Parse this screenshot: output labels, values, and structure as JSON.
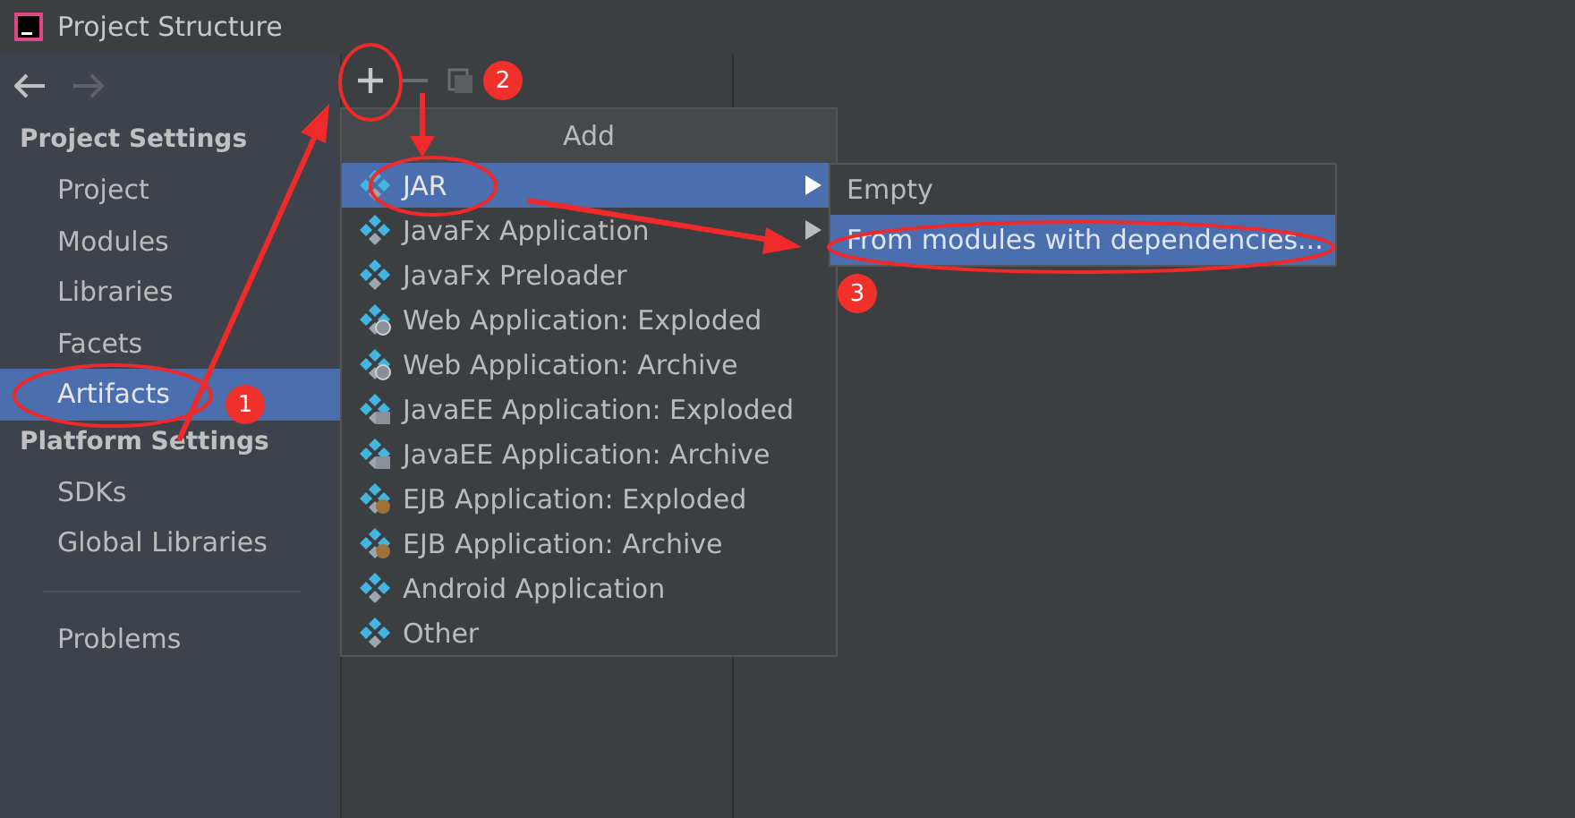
{
  "window": {
    "title": "Project Structure"
  },
  "sidebar": {
    "sections": [
      {
        "title": "Project Settings",
        "items": [
          {
            "label": "Project",
            "selected": false
          },
          {
            "label": "Modules",
            "selected": false
          },
          {
            "label": "Libraries",
            "selected": false
          },
          {
            "label": "Facets",
            "selected": false
          },
          {
            "label": "Artifacts",
            "selected": true
          }
        ]
      },
      {
        "title": "Platform Settings",
        "items": [
          {
            "label": "SDKs",
            "selected": false
          },
          {
            "label": "Global Libraries",
            "selected": false
          }
        ]
      }
    ],
    "footer_items": [
      {
        "label": "Problems",
        "selected": false
      }
    ]
  },
  "add_menu": {
    "title": "Add",
    "items": [
      {
        "label": "JAR",
        "kind": "plain",
        "submenu": true,
        "selected": true
      },
      {
        "label": "JavaFx Application",
        "kind": "plain",
        "submenu": true,
        "selected": false
      },
      {
        "label": "JavaFx Preloader",
        "kind": "plain",
        "submenu": false,
        "selected": false
      },
      {
        "label": "Web Application: Exploded",
        "kind": "web",
        "submenu": false,
        "selected": false
      },
      {
        "label": "Web Application: Archive",
        "kind": "web",
        "submenu": false,
        "selected": false
      },
      {
        "label": "JavaEE Application: Exploded",
        "kind": "javaee",
        "submenu": false,
        "selected": false
      },
      {
        "label": "JavaEE Application: Archive",
        "kind": "javaee",
        "submenu": false,
        "selected": false
      },
      {
        "label": "EJB Application: Exploded",
        "kind": "ejb",
        "submenu": false,
        "selected": false
      },
      {
        "label": "EJB Application: Archive",
        "kind": "ejb",
        "submenu": false,
        "selected": false
      },
      {
        "label": "Android Application",
        "kind": "plain",
        "submenu": false,
        "selected": false
      },
      {
        "label": "Other",
        "kind": "plain",
        "submenu": false,
        "selected": false
      }
    ]
  },
  "jar_submenu": {
    "items": [
      {
        "label": "Empty",
        "selected": false
      },
      {
        "label": "From modules with dependencies...",
        "selected": true
      }
    ]
  },
  "annotations": {
    "badges": [
      "1",
      "2",
      "3"
    ]
  }
}
